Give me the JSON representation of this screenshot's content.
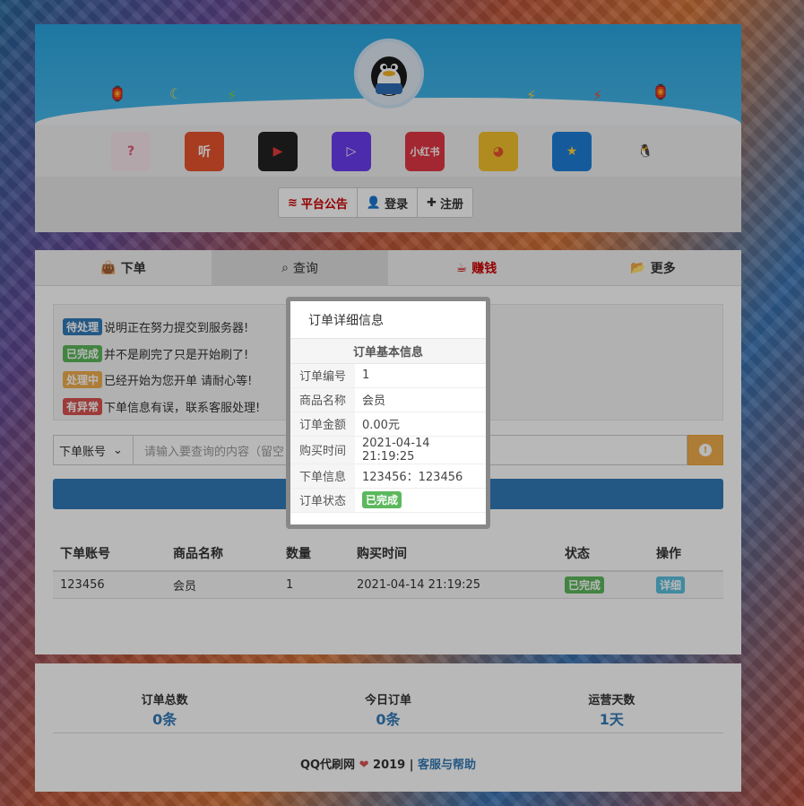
{
  "header": {
    "apps": [
      {
        "name": "quiz-app-icon",
        "glyph": "?",
        "bg": "#f7e6ee",
        "fg": "#e05a7a"
      },
      {
        "name": "listen-app-icon",
        "glyph": "听",
        "bg": "#e8542f",
        "fg": "#ffffff"
      },
      {
        "name": "video-red-app-icon",
        "glyph": "▶",
        "bg": "#222222",
        "fg": "#e83a3a"
      },
      {
        "name": "video-purple-app-icon",
        "glyph": "▷",
        "bg": "#6a3cf0",
        "fg": "#ffffff"
      },
      {
        "name": "xiaohongshu-app-icon",
        "glyph": "小红书",
        "bg": "#e23743",
        "fg": "#ffffff"
      },
      {
        "name": "cartoon-app-icon",
        "glyph": "◕",
        "bg": "#f4c12b",
        "fg": "#e8542f"
      },
      {
        "name": "star-app-icon",
        "glyph": "★",
        "bg": "#1e7fd8",
        "fg": "#ffd43a"
      },
      {
        "name": "penguin-app-icon",
        "glyph": "🐧",
        "bg": "#f0f0f0",
        "fg": "#111111"
      }
    ],
    "buttons": {
      "notice": "平台公告",
      "login": "登录",
      "register": "注册"
    }
  },
  "tabs": [
    {
      "label": "下单",
      "icon": "bag-icon"
    },
    {
      "label": "查询",
      "icon": "search-icon"
    },
    {
      "label": "赚钱",
      "icon": "cup-icon"
    },
    {
      "label": "更多",
      "icon": "folder-icon"
    }
  ],
  "notes": [
    {
      "badge": "待处理",
      "text": "说明正在努力提交到服务器!"
    },
    {
      "badge": "已完成",
      "text": "并不是刷完了只是开始刷了!"
    },
    {
      "badge": "处理中",
      "text": "已经开始为您开单 请耐心等!"
    },
    {
      "badge": "有异常",
      "text": "下单信息有误，联系客服处理!"
    }
  ],
  "search": {
    "select_value": "下单账号",
    "placeholder": "请输入要查询的内容（留空"
  },
  "orders": {
    "headers": [
      "下单账号",
      "商品名称",
      "数量",
      "购买时间",
      "",
      "状态",
      "操作"
    ],
    "rows": [
      {
        "account": "123456",
        "product": "会员",
        "qty": "1",
        "time": "2021-04-14 21:19:25",
        "status": "已完成",
        "action": "详细"
      }
    ]
  },
  "stats": [
    {
      "title": "订单总数",
      "value": "0条"
    },
    {
      "title": "今日订单",
      "value": "0条"
    },
    {
      "title": "运营天数",
      "value": "1天"
    }
  ],
  "footer": {
    "site": "QQ代刷网",
    "year": "2019",
    "sep": "|",
    "help": "客服与帮助"
  },
  "modal": {
    "title": "订单详细信息",
    "section": "订单基本信息",
    "fields": [
      {
        "key": "订单编号",
        "value": "1"
      },
      {
        "key": "商品名称",
        "value": "会员"
      },
      {
        "key": "订单金额",
        "value": "0.00元"
      },
      {
        "key": "购买时间",
        "value": "2021-04-14 21:19:25"
      },
      {
        "key": "下单信息",
        "value": "123456：123456"
      },
      {
        "key": "订单状态",
        "value": "已完成"
      }
    ]
  },
  "colors": {
    "primary": "#337ab7",
    "success": "#5cb85c",
    "warning": "#f0ad4e",
    "danger": "#d9534f"
  }
}
